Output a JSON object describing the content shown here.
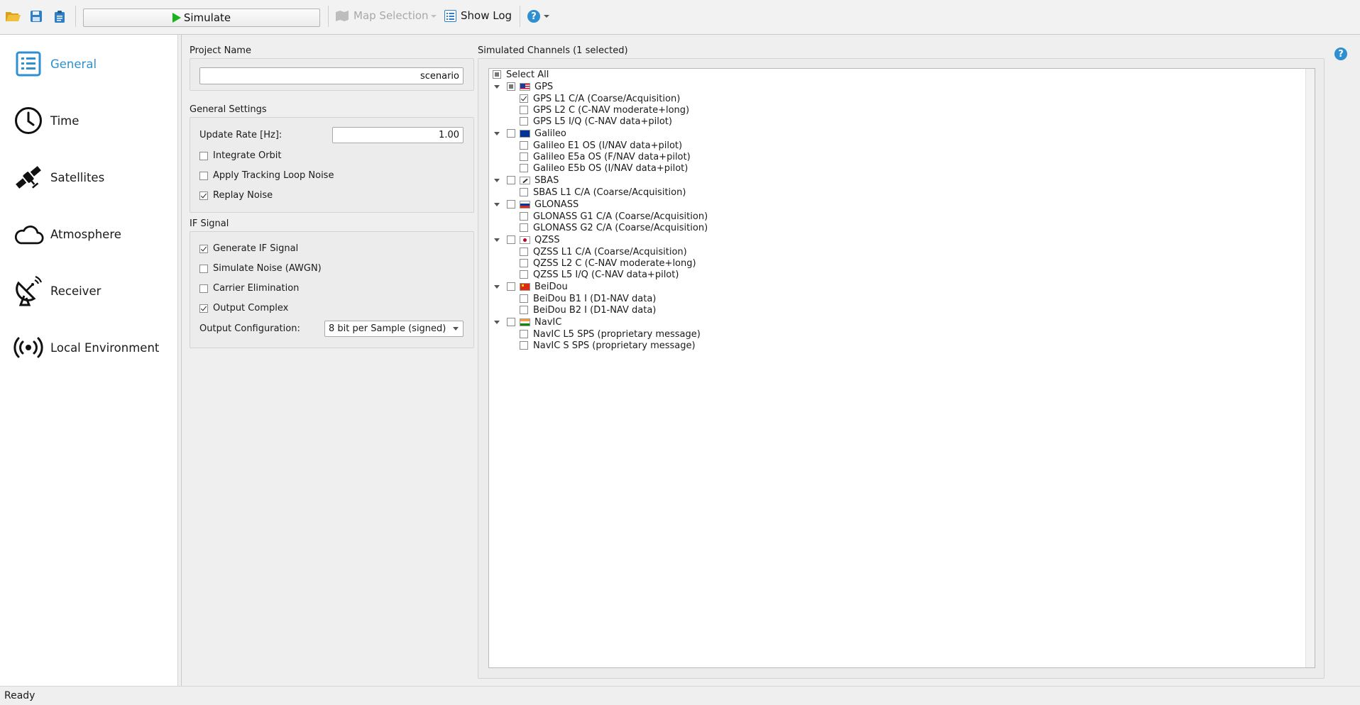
{
  "toolbar": {
    "simulate_label": "Simulate",
    "map_selection_label": "Map Selection",
    "show_log_label": "Show Log"
  },
  "sidebar": {
    "items": [
      {
        "label": "General",
        "icon": "list-icon",
        "active": true
      },
      {
        "label": "Time",
        "icon": "clock-icon"
      },
      {
        "label": "Satellites",
        "icon": "satellite-icon"
      },
      {
        "label": "Atmosphere",
        "icon": "cloud-icon"
      },
      {
        "label": "Receiver",
        "icon": "dish-icon"
      },
      {
        "label": "Local Environment",
        "icon": "broadcast-icon"
      }
    ]
  },
  "general": {
    "project_name_title": "Project Name",
    "project_name_value": "scenario",
    "general_settings_title": "General Settings",
    "update_rate_label": "Update Rate [Hz]:",
    "update_rate_value": "1.00",
    "integrate_orbit": "Integrate Orbit",
    "apply_tracking_noise": "Apply Tracking Loop Noise",
    "replay_noise": "Replay Noise",
    "if_signal_title": "IF Signal",
    "generate_if": "Generate IF Signal",
    "simulate_noise": "Simulate Noise (AWGN)",
    "carrier_elim": "Carrier Elimination",
    "output_complex": "Output Complex",
    "output_config_label": "Output Configuration:",
    "output_config_value": "8 bit per Sample (signed)"
  },
  "channels": {
    "title": "Simulated Channels (1 selected)",
    "select_all": "Select All",
    "groups": [
      {
        "name": "GPS",
        "signals": [
          "GPS L1 C/A  (Coarse/Acquisition)",
          "GPS L2 C  (C-NAV moderate+long)",
          "GPS L5 I/Q  (C-NAV data+pilot)"
        ]
      },
      {
        "name": "Galileo",
        "signals": [
          "Galileo E1 OS  (I/NAV data+pilot)",
          "Galileo E5a OS  (F/NAV data+pilot)",
          "Galileo E5b OS  (I/NAV data+pilot)"
        ]
      },
      {
        "name": "SBAS",
        "signals": [
          "SBAS L1 C/A  (Coarse/Acquisition)"
        ]
      },
      {
        "name": "GLONASS",
        "signals": [
          "GLONASS G1 C/A  (Coarse/Acquisition)",
          "GLONASS G2 C/A  (Coarse/Acquisition)"
        ]
      },
      {
        "name": "QZSS",
        "signals": [
          "QZSS L1 C/A  (Coarse/Acquisition)",
          "QZSS L2 C  (C-NAV moderate+long)",
          "QZSS L5 I/Q  (C-NAV data+pilot)"
        ]
      },
      {
        "name": "BeiDou",
        "signals": [
          "BeiDou B1 I  (D1-NAV data)",
          "BeiDou B2 I  (D1-NAV data)"
        ]
      },
      {
        "name": "NavIC",
        "signals": [
          "NavIC L5 SPS  (proprietary message)",
          "NavIC S SPS  (proprietary message)"
        ]
      }
    ]
  },
  "status": {
    "text": "Ready"
  },
  "colors": {
    "accent": "#2e8fd1",
    "play": "#19b31d"
  }
}
